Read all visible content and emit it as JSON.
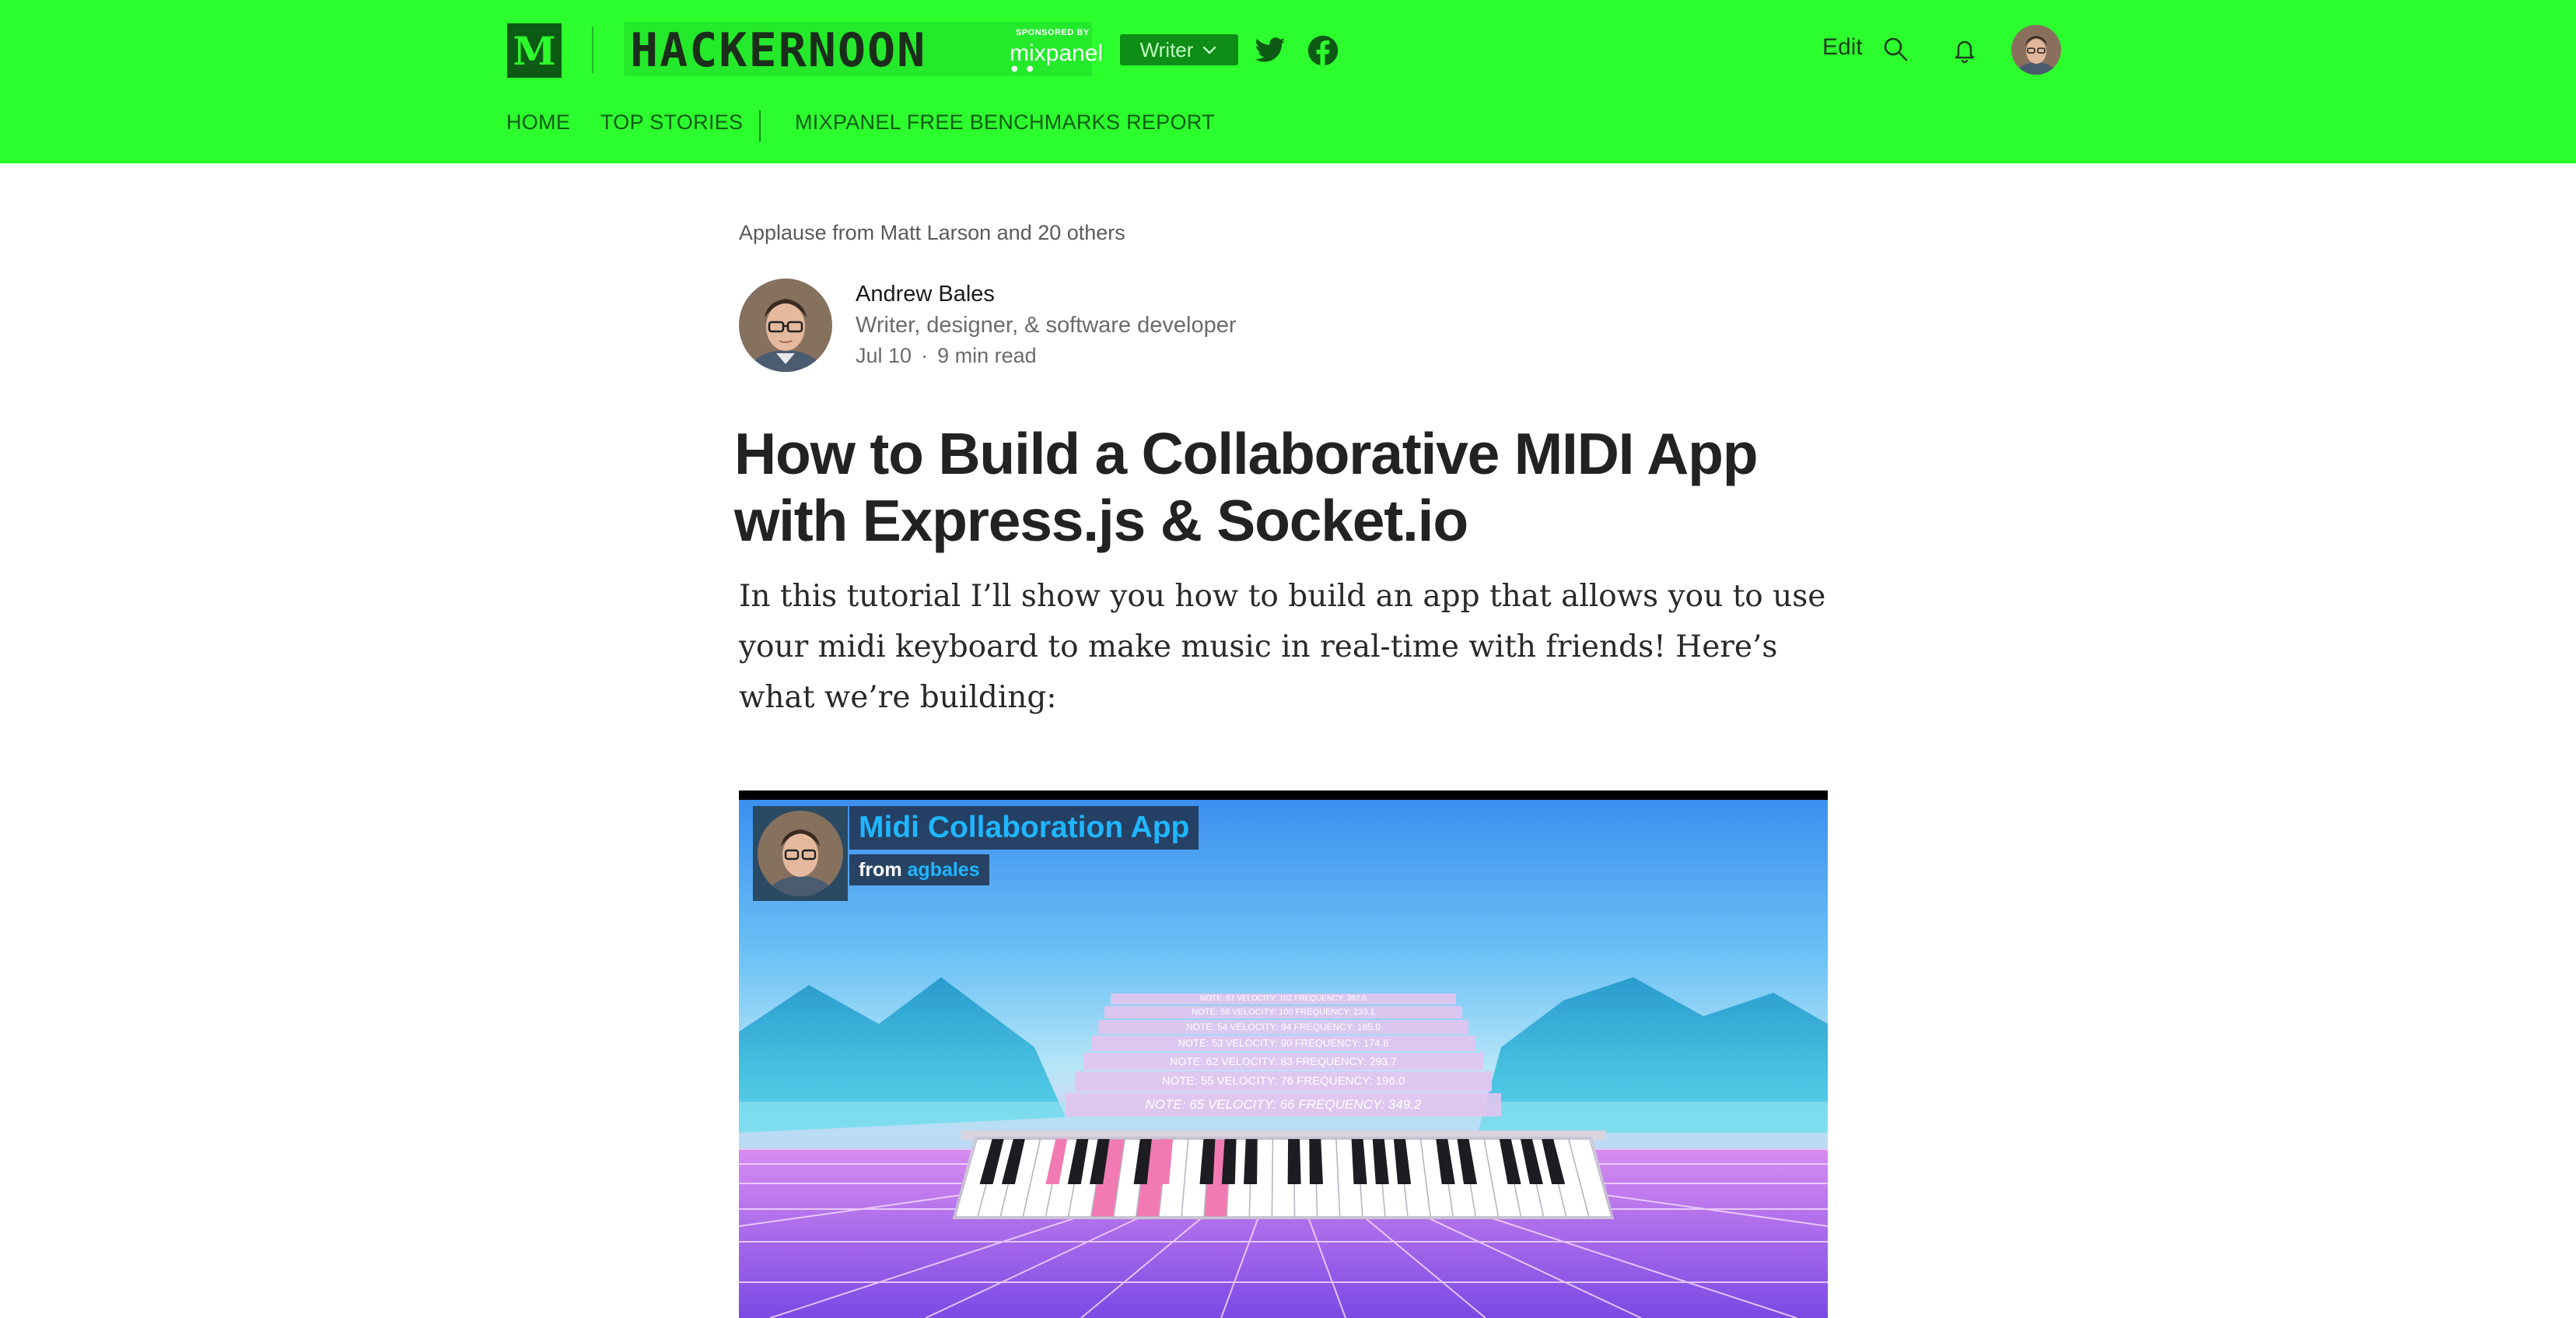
{
  "header": {
    "brand_letter": "M",
    "publication_name": "HACKERNOON",
    "sponsor_label": "SPONSORED BY",
    "sponsor_name": "mixpanel",
    "role_button": "Writer",
    "edit_label": "Edit",
    "colors": {
      "background": "#2cff2d",
      "accent": "#0e8d17"
    },
    "icons": [
      "chevron-down-icon",
      "twitter-icon",
      "facebook-icon",
      "search-icon",
      "bell-icon"
    ]
  },
  "nav": {
    "items": [
      {
        "label": "HOME"
      },
      {
        "label": "TOP STORIES"
      },
      {
        "label": "MIXPANEL FREE BENCHMARKS REPORT"
      }
    ]
  },
  "article": {
    "applause": "Applause from Matt Larson and 20 others",
    "author": {
      "name": "Andrew Bales",
      "bio": "Writer, designer, & software developer",
      "date": "Jul 10",
      "read_time": "9 min read"
    },
    "title": "How to Build a Collaborative MIDI App with Express.js & Socket.io",
    "intro": "In this tutorial I’ll show you how to build an app that allows you to use your midi keyboard to make music in real-time with friends! Here’s what we’re building:"
  },
  "video": {
    "title": "Midi Collaboration App",
    "by_prefix": "from",
    "by_user": "agbales",
    "note_lines": [
      "NOTE: 67 VELOCITY: 102 FREQUENCY: 392.0",
      "NOTE: 58 VELOCITY: 100 FREQUENCY: 233.1",
      "NOTE: 54 VELOCITY: 94 FREQUENCY: 185.0",
      "NOTE: 53 VELOCITY: 90 FREQUENCY: 174.6",
      "NOTE: 62 VELOCITY: 83 FREQUENCY: 293.7",
      "NOTE: 55 VELOCITY: 76 FREQUENCY: 196.0",
      "NOTE: 65 VELOCITY: 66 FREQUENCY: 349.2"
    ],
    "colors": {
      "sky": "#3aa0f0",
      "grid": "#b46cf0",
      "highlight_key": "#f27ab2"
    }
  }
}
